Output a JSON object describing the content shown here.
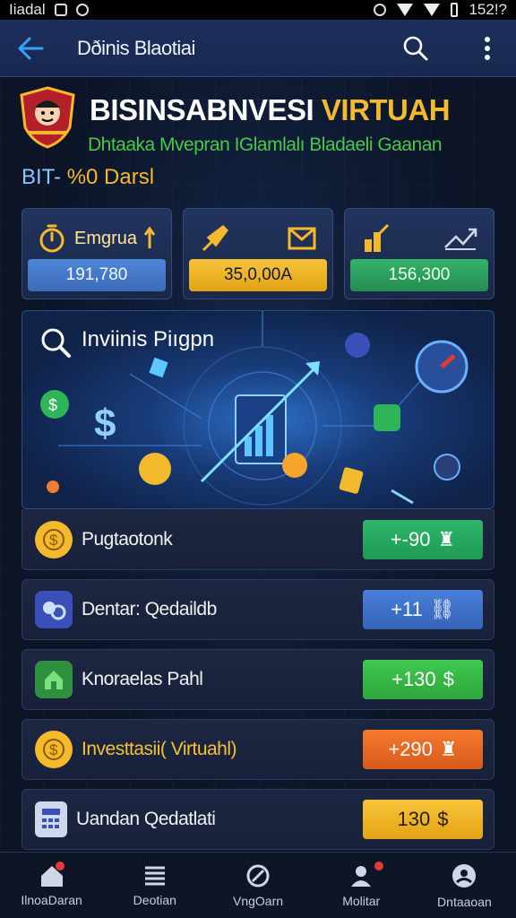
{
  "status_bar": {
    "left_text": "Iiadal",
    "time": "152!?"
  },
  "app_bar": {
    "title": "Dðinis Blaotiai"
  },
  "header": {
    "title_part1": "BISINSABNVESI",
    "title_part2": "VIRTUAH",
    "subtitle": "Dhtaaka Mvepran IGlamlalı Bladaeli Gaanan",
    "bit_label": "BIT-",
    "bit_value": "%0 Darsl"
  },
  "stats": [
    {
      "label": "Emgrua",
      "value": "191,780"
    },
    {
      "label": "",
      "value": "35,0,00A"
    },
    {
      "label": "",
      "value": "156,300"
    }
  ],
  "banner": {
    "title": "Inviinis Piıgpn"
  },
  "rows": [
    {
      "label": "Pugtaotonk",
      "value": "+-90",
      "color": "#2eb66a"
    },
    {
      "label": "Dentar: Qedaildb",
      "value": "+11",
      "color": "#4a7fda"
    },
    {
      "label": "Knoraelas Pahl",
      "value": "+130",
      "color": "#3fc94f"
    },
    {
      "label": "Investtasii( Virtuahl)",
      "value": "+290",
      "color": "#f47a2e"
    },
    {
      "label": "Uandan Qedatlati",
      "value": "130",
      "color": "#f8c53a"
    }
  ],
  "bottom_nav": [
    {
      "label": "IlnoaDaran",
      "icon": "home-icon"
    },
    {
      "label": "Deotian",
      "icon": "list-icon"
    },
    {
      "label": "VngOarn",
      "icon": "target-icon"
    },
    {
      "label": "Molitar",
      "icon": "user-icon"
    },
    {
      "label": "Dntaaoan",
      "icon": "account-icon"
    }
  ],
  "colors": {
    "accent_blue": "#3aa0ff",
    "gold": "#f4b92c",
    "green": "#48c84a",
    "background": "#0c1426"
  }
}
